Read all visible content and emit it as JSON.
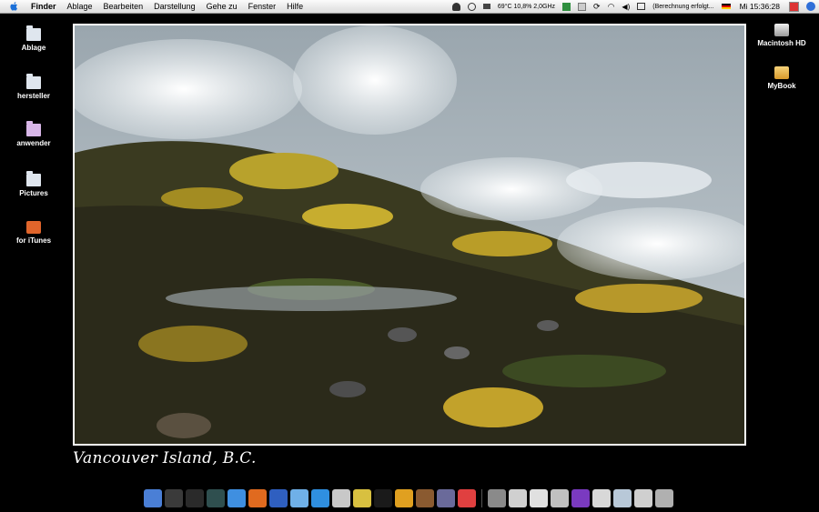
{
  "menubar": {
    "app_name": "Finder",
    "menus": [
      "Ablage",
      "Bearbeiten",
      "Darstellung",
      "Gehe zu",
      "Fenster",
      "Hilfe"
    ],
    "status_text": "69°C 10,8% 2,0GHz",
    "input_status": "(Berechnung erfolgt...",
    "clock": "Mi 15:36:28",
    "icons": [
      "user-icon",
      "sync-icon",
      "cpu-monitor-icon",
      "excel-icon",
      "document-icon",
      "refresh-icon",
      "wifi-icon",
      "volume-icon",
      "keyboard-icon",
      "flag-de-icon",
      "calendar-icon",
      "spotlight-icon"
    ]
  },
  "desktop_left": [
    {
      "label": "Ablage",
      "icon": "folder-icon"
    },
    {
      "label": "hersteller",
      "icon": "folder-icon"
    },
    {
      "label": "anwender",
      "icon": "folder-icon"
    },
    {
      "label": "Pictures",
      "icon": "folder-icon"
    },
    {
      "label": "for iTunes",
      "icon": "itunes-folder-icon"
    }
  ],
  "desktop_right": [
    {
      "label": "Macintosh HD",
      "icon": "hard-drive-icon"
    },
    {
      "label": "MyBook",
      "icon": "external-drive-icon"
    }
  ],
  "wallpaper": {
    "caption": "Vancouver Island, B.C."
  },
  "dock": {
    "apps": [
      {
        "name": "finder-icon",
        "color": "#4a7fd6"
      },
      {
        "name": "dashboard-icon",
        "color": "#3a3a3a"
      },
      {
        "name": "terminal-icon",
        "color": "#2a2a2a"
      },
      {
        "name": "activity-monitor-icon",
        "color": "#2f4f4f"
      },
      {
        "name": "safari-icon",
        "color": "#3f8fe0"
      },
      {
        "name": "firefox-icon",
        "color": "#e06a1f"
      },
      {
        "name": "app-blue-icon",
        "color": "#2f5fc0"
      },
      {
        "name": "itunes-icon",
        "color": "#6fb0e8"
      },
      {
        "name": "quicktime-icon",
        "color": "#2f8fe0"
      },
      {
        "name": "iphoto-icon",
        "color": "#c8c8c8"
      },
      {
        "name": "grid-app-icon",
        "color": "#d8c040"
      },
      {
        "name": "nx2-icon",
        "color": "#1a1a1a"
      },
      {
        "name": "pencil-app-icon",
        "color": "#e0a020"
      },
      {
        "name": "coffee-app-icon",
        "color": "#8a5a30"
      },
      {
        "name": "utility-app-icon",
        "color": "#6a6a9a"
      },
      {
        "name": "calendar-app-icon",
        "color": "#e04040"
      }
    ],
    "docs": [
      {
        "name": "preview-doc-icon",
        "color": "#8a8a8a"
      },
      {
        "name": "window-doc-icon",
        "color": "#d0d0d0"
      },
      {
        "name": "window-doc-icon-2",
        "color": "#e0e0e0"
      },
      {
        "name": "window-doc-icon-3",
        "color": "#c0c0c0"
      },
      {
        "name": "purple-window-icon",
        "color": "#7a3ac0"
      },
      {
        "name": "window-doc-icon-4",
        "color": "#d8d8d8"
      },
      {
        "name": "window-doc-icon-5",
        "color": "#b8c8d8"
      },
      {
        "name": "window-doc-icon-6",
        "color": "#cfcfcf"
      },
      {
        "name": "trash-icon",
        "color": "#b0b0b0"
      }
    ]
  }
}
